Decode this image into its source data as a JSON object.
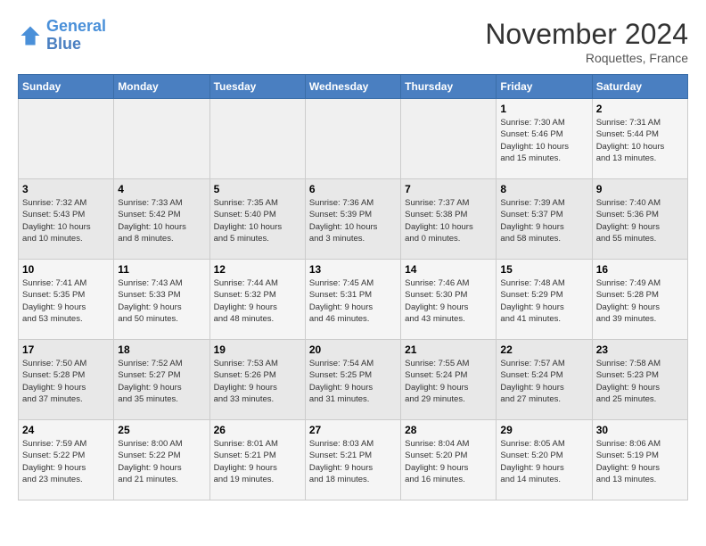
{
  "header": {
    "logo_line1": "General",
    "logo_line2": "Blue",
    "month_year": "November 2024",
    "location": "Roquettes, France"
  },
  "weekdays": [
    "Sunday",
    "Monday",
    "Tuesday",
    "Wednesday",
    "Thursday",
    "Friday",
    "Saturday"
  ],
  "weeks": [
    [
      {
        "day": "",
        "info": ""
      },
      {
        "day": "",
        "info": ""
      },
      {
        "day": "",
        "info": ""
      },
      {
        "day": "",
        "info": ""
      },
      {
        "day": "",
        "info": ""
      },
      {
        "day": "1",
        "info": "Sunrise: 7:30 AM\nSunset: 5:46 PM\nDaylight: 10 hours\nand 15 minutes."
      },
      {
        "day": "2",
        "info": "Sunrise: 7:31 AM\nSunset: 5:44 PM\nDaylight: 10 hours\nand 13 minutes."
      }
    ],
    [
      {
        "day": "3",
        "info": "Sunrise: 7:32 AM\nSunset: 5:43 PM\nDaylight: 10 hours\nand 10 minutes."
      },
      {
        "day": "4",
        "info": "Sunrise: 7:33 AM\nSunset: 5:42 PM\nDaylight: 10 hours\nand 8 minutes."
      },
      {
        "day": "5",
        "info": "Sunrise: 7:35 AM\nSunset: 5:40 PM\nDaylight: 10 hours\nand 5 minutes."
      },
      {
        "day": "6",
        "info": "Sunrise: 7:36 AM\nSunset: 5:39 PM\nDaylight: 10 hours\nand 3 minutes."
      },
      {
        "day": "7",
        "info": "Sunrise: 7:37 AM\nSunset: 5:38 PM\nDaylight: 10 hours\nand 0 minutes."
      },
      {
        "day": "8",
        "info": "Sunrise: 7:39 AM\nSunset: 5:37 PM\nDaylight: 9 hours\nand 58 minutes."
      },
      {
        "day": "9",
        "info": "Sunrise: 7:40 AM\nSunset: 5:36 PM\nDaylight: 9 hours\nand 55 minutes."
      }
    ],
    [
      {
        "day": "10",
        "info": "Sunrise: 7:41 AM\nSunset: 5:35 PM\nDaylight: 9 hours\nand 53 minutes."
      },
      {
        "day": "11",
        "info": "Sunrise: 7:43 AM\nSunset: 5:33 PM\nDaylight: 9 hours\nand 50 minutes."
      },
      {
        "day": "12",
        "info": "Sunrise: 7:44 AM\nSunset: 5:32 PM\nDaylight: 9 hours\nand 48 minutes."
      },
      {
        "day": "13",
        "info": "Sunrise: 7:45 AM\nSunset: 5:31 PM\nDaylight: 9 hours\nand 46 minutes."
      },
      {
        "day": "14",
        "info": "Sunrise: 7:46 AM\nSunset: 5:30 PM\nDaylight: 9 hours\nand 43 minutes."
      },
      {
        "day": "15",
        "info": "Sunrise: 7:48 AM\nSunset: 5:29 PM\nDaylight: 9 hours\nand 41 minutes."
      },
      {
        "day": "16",
        "info": "Sunrise: 7:49 AM\nSunset: 5:28 PM\nDaylight: 9 hours\nand 39 minutes."
      }
    ],
    [
      {
        "day": "17",
        "info": "Sunrise: 7:50 AM\nSunset: 5:28 PM\nDaylight: 9 hours\nand 37 minutes."
      },
      {
        "day": "18",
        "info": "Sunrise: 7:52 AM\nSunset: 5:27 PM\nDaylight: 9 hours\nand 35 minutes."
      },
      {
        "day": "19",
        "info": "Sunrise: 7:53 AM\nSunset: 5:26 PM\nDaylight: 9 hours\nand 33 minutes."
      },
      {
        "day": "20",
        "info": "Sunrise: 7:54 AM\nSunset: 5:25 PM\nDaylight: 9 hours\nand 31 minutes."
      },
      {
        "day": "21",
        "info": "Sunrise: 7:55 AM\nSunset: 5:24 PM\nDaylight: 9 hours\nand 29 minutes."
      },
      {
        "day": "22",
        "info": "Sunrise: 7:57 AM\nSunset: 5:24 PM\nDaylight: 9 hours\nand 27 minutes."
      },
      {
        "day": "23",
        "info": "Sunrise: 7:58 AM\nSunset: 5:23 PM\nDaylight: 9 hours\nand 25 minutes."
      }
    ],
    [
      {
        "day": "24",
        "info": "Sunrise: 7:59 AM\nSunset: 5:22 PM\nDaylight: 9 hours\nand 23 minutes."
      },
      {
        "day": "25",
        "info": "Sunrise: 8:00 AM\nSunset: 5:22 PM\nDaylight: 9 hours\nand 21 minutes."
      },
      {
        "day": "26",
        "info": "Sunrise: 8:01 AM\nSunset: 5:21 PM\nDaylight: 9 hours\nand 19 minutes."
      },
      {
        "day": "27",
        "info": "Sunrise: 8:03 AM\nSunset: 5:21 PM\nDaylight: 9 hours\nand 18 minutes."
      },
      {
        "day": "28",
        "info": "Sunrise: 8:04 AM\nSunset: 5:20 PM\nDaylight: 9 hours\nand 16 minutes."
      },
      {
        "day": "29",
        "info": "Sunrise: 8:05 AM\nSunset: 5:20 PM\nDaylight: 9 hours\nand 14 minutes."
      },
      {
        "day": "30",
        "info": "Sunrise: 8:06 AM\nSunset: 5:19 PM\nDaylight: 9 hours\nand 13 minutes."
      }
    ]
  ]
}
